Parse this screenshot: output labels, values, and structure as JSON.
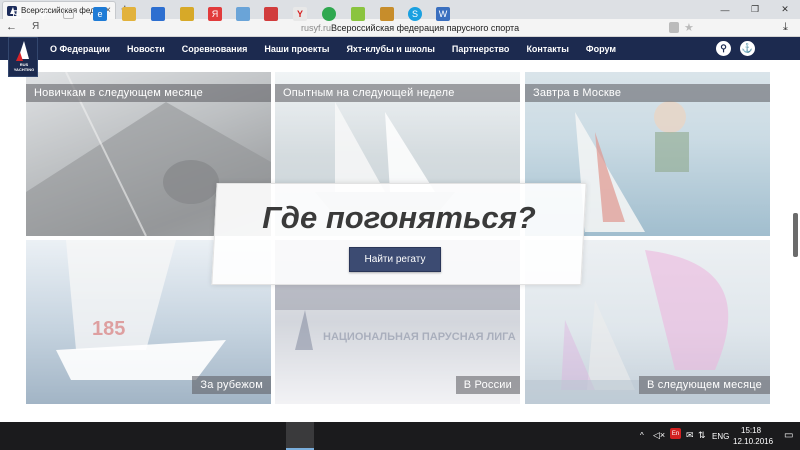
{
  "browser": {
    "tab_title": "Всероссийская федерация",
    "tab_close": "×",
    "new_tab": "+",
    "window_buttons": [
      "—",
      "❐",
      "✕"
    ],
    "back": "←",
    "yandex_label": "Я",
    "url_domain": "rusyf.ru",
    "url_title": "Всероссийская федерация парусного спорта"
  },
  "site": {
    "logo_text": "RUS YACHTING",
    "nav": [
      "О Федерации",
      "Новости",
      "Соревнования",
      "Наши проекты",
      "Яхт-клубы и школы",
      "Партнерство",
      "Контакты",
      "Форум"
    ]
  },
  "tiles": [
    {
      "label": "Новичкам в следующем месяце"
    },
    {
      "label": "Опытным на следующей неделе"
    },
    {
      "label": "Завтра в Москве"
    },
    {
      "label": "За рубежом"
    },
    {
      "label": "В России"
    },
    {
      "label": "В следующем месяце"
    }
  ],
  "tile_texts": {
    "sail_number": "185",
    "league_text": "НАЦИОНАЛЬНАЯ ПАРУСНАЯ ЛИГА"
  },
  "cta": {
    "title": "Где погоняться?",
    "button": "Найти регату"
  },
  "taskbar": {
    "lang": "ENG",
    "time": "15:18",
    "date": "12.10.2016"
  },
  "colors": {
    "nav_bg": "#1c2a4f",
    "cta_button": "#3c4b72",
    "taskbar": "#1b1b1d"
  }
}
